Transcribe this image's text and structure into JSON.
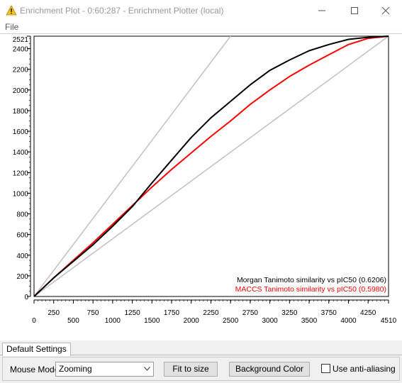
{
  "window": {
    "title": "Enrichment Plot - 0:60:287 - Enrichment Plotter (local)",
    "icon": "warning-triangle-icon",
    "controls": [
      "minimize-icon",
      "maximize-icon",
      "close-icon"
    ]
  },
  "menu": {
    "file": "File"
  },
  "chart_data": {
    "type": "line",
    "x_ticks": [
      "0",
      "250",
      "500",
      "750",
      "1000",
      "1250",
      "1500",
      "1750",
      "2000",
      "2250",
      "2500",
      "2750",
      "3000",
      "3250",
      "3500",
      "3750",
      "4000",
      "4250",
      "4510"
    ],
    "y_ticks": [
      "0",
      "200",
      "400",
      "600",
      "800",
      "1000",
      "1200",
      "1400",
      "1600",
      "1800",
      "2000",
      "2200",
      "2400",
      "2521"
    ],
    "xlim": [
      0,
      4510
    ],
    "ylim": [
      0,
      2521
    ],
    "series": [
      {
        "name": "Morgan Tanimoto similarity vs pIC50 (0.6206)",
        "color": "#000000",
        "x": [
          0,
          250,
          500,
          750,
          1000,
          1250,
          1500,
          1750,
          2000,
          2250,
          2500,
          2750,
          3000,
          3250,
          3500,
          3750,
          4000,
          4250,
          4510
        ],
        "y": [
          0,
          180,
          340,
          500,
          680,
          870,
          1100,
          1320,
          1540,
          1730,
          1890,
          2050,
          2190,
          2290,
          2380,
          2440,
          2490,
          2510,
          2521
        ]
      },
      {
        "name": "MACCS Tanimoto similarity vs pIC50 (0.5980)",
        "color": "#ff0000",
        "x": [
          0,
          250,
          500,
          750,
          1000,
          1250,
          1500,
          1750,
          2000,
          2250,
          2500,
          2750,
          3000,
          3250,
          3500,
          3750,
          4000,
          4250,
          4510
        ],
        "y": [
          0,
          180,
          350,
          520,
          700,
          880,
          1060,
          1230,
          1390,
          1550,
          1700,
          1860,
          2000,
          2130,
          2240,
          2340,
          2440,
          2500,
          2521
        ]
      },
      {
        "name": "",
        "color": "#c0c0c0",
        "x": [
          0,
          2500
        ],
        "y": [
          0,
          2521
        ]
      },
      {
        "name": "",
        "color": "#c0c0c0",
        "x": [
          0,
          4510
        ],
        "y": [
          0,
          2521
        ]
      }
    ],
    "legend_position": "bottom-right",
    "grid": false
  },
  "tabs": [
    "Default Settings"
  ],
  "controls": {
    "mouse_mode_label": "Mouse Mode",
    "mouse_mode_value": "Zooming",
    "fit_button": "Fit to size",
    "background_button": "Background Color",
    "antialias_label": "Use anti-aliasing",
    "antialias_checked": false
  }
}
